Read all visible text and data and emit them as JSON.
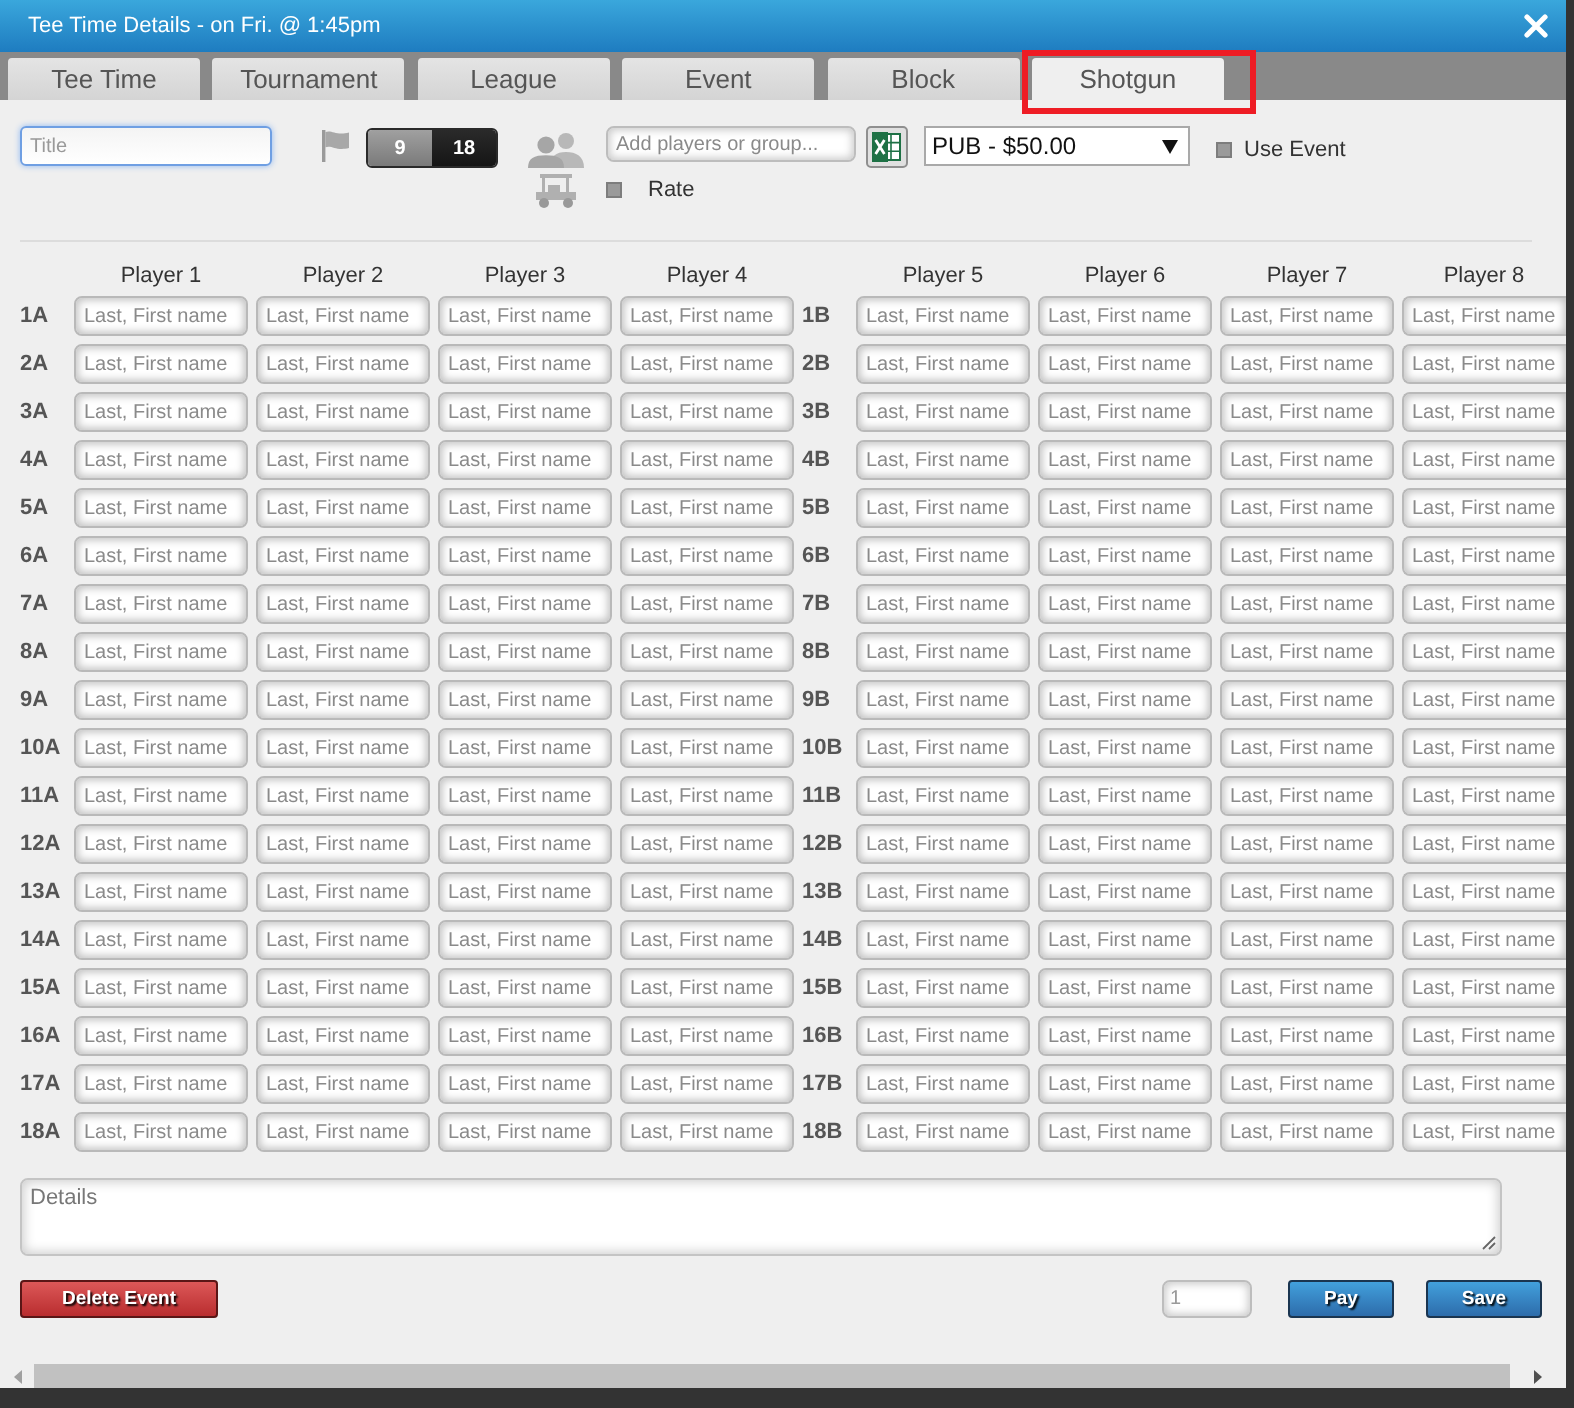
{
  "window": {
    "title": "Tee Time Details - on Fri. @ 1:45pm"
  },
  "tabs": [
    {
      "label": "Tee Time",
      "selected": false,
      "highlighted": false
    },
    {
      "label": "Tournament",
      "selected": false,
      "highlighted": false
    },
    {
      "label": "League",
      "selected": false,
      "highlighted": false
    },
    {
      "label": "Event",
      "selected": false,
      "highlighted": false
    },
    {
      "label": "Block",
      "selected": false,
      "highlighted": false
    },
    {
      "label": "Shotgun",
      "selected": true,
      "highlighted": true
    }
  ],
  "toolbar": {
    "title_field": {
      "placeholder": "Title",
      "focused": true
    },
    "holes": [
      {
        "label": "9",
        "selected": false
      },
      {
        "label": "18",
        "selected": true
      }
    ],
    "players_field": {
      "placeholder": "Add players or group..."
    },
    "rate_checkbox": {
      "label": "Rate",
      "checked": false
    },
    "rate_select": {
      "value": "PUB - $50.00"
    },
    "use_event_checkbox": {
      "label": "Use Event",
      "checked": false
    }
  },
  "grid": {
    "columns": [
      "Player 1",
      "Player 2",
      "Player 3",
      "Player 4",
      "Player 5",
      "Player 6",
      "Player 7",
      "Player 8"
    ],
    "rows": [
      {
        "label_a": "1A",
        "label_b": "1B",
        "slots": [
          {
            "placeholder": "Last, First name"
          },
          {
            "placeholder": "Last, First name"
          },
          {
            "placeholder": "Last, First name"
          },
          {
            "placeholder": "Last, First name"
          },
          {
            "placeholder": "Last, First name"
          },
          {
            "placeholder": "Last, First name"
          },
          {
            "placeholder": "Last, First name"
          },
          {
            "placeholder": "Last, First name"
          }
        ]
      },
      {
        "label_a": "2A",
        "label_b": "2B",
        "slots": [
          {
            "placeholder": "Last, First name"
          },
          {
            "placeholder": "Last, First name"
          },
          {
            "placeholder": "Last, First name"
          },
          {
            "placeholder": "Last, First name"
          },
          {
            "placeholder": "Last, First name"
          },
          {
            "placeholder": "Last, First name"
          },
          {
            "placeholder": "Last, First name"
          },
          {
            "placeholder": "Last, First name"
          }
        ]
      },
      {
        "label_a": "3A",
        "label_b": "3B",
        "slots": [
          {
            "placeholder": "Last, First name"
          },
          {
            "placeholder": "Last, First name"
          },
          {
            "placeholder": "Last, First name"
          },
          {
            "placeholder": "Last, First name"
          },
          {
            "placeholder": "Last, First name"
          },
          {
            "placeholder": "Last, First name"
          },
          {
            "placeholder": "Last, First name"
          },
          {
            "placeholder": "Last, First name"
          }
        ]
      },
      {
        "label_a": "4A",
        "label_b": "4B",
        "slots": [
          {
            "placeholder": "Last, First name"
          },
          {
            "placeholder": "Last, First name"
          },
          {
            "placeholder": "Last, First name"
          },
          {
            "placeholder": "Last, First name"
          },
          {
            "placeholder": "Last, First name"
          },
          {
            "placeholder": "Last, First name"
          },
          {
            "placeholder": "Last, First name"
          },
          {
            "placeholder": "Last, First name"
          }
        ]
      },
      {
        "label_a": "5A",
        "label_b": "5B",
        "slots": [
          {
            "placeholder": "Last, First name"
          },
          {
            "placeholder": "Last, First name"
          },
          {
            "placeholder": "Last, First name"
          },
          {
            "placeholder": "Last, First name"
          },
          {
            "placeholder": "Last, First name"
          },
          {
            "placeholder": "Last, First name"
          },
          {
            "placeholder": "Last, First name"
          },
          {
            "placeholder": "Last, First name"
          }
        ]
      },
      {
        "label_a": "6A",
        "label_b": "6B",
        "slots": [
          {
            "placeholder": "Last, First name"
          },
          {
            "placeholder": "Last, First name"
          },
          {
            "placeholder": "Last, First name"
          },
          {
            "placeholder": "Last, First name"
          },
          {
            "placeholder": "Last, First name"
          },
          {
            "placeholder": "Last, First name"
          },
          {
            "placeholder": "Last, First name"
          },
          {
            "placeholder": "Last, First name"
          }
        ]
      },
      {
        "label_a": "7A",
        "label_b": "7B",
        "slots": [
          {
            "placeholder": "Last, First name"
          },
          {
            "placeholder": "Last, First name"
          },
          {
            "placeholder": "Last, First name"
          },
          {
            "placeholder": "Last, First name"
          },
          {
            "placeholder": "Last, First name"
          },
          {
            "placeholder": "Last, First name"
          },
          {
            "placeholder": "Last, First name"
          },
          {
            "placeholder": "Last, First name"
          }
        ]
      },
      {
        "label_a": "8A",
        "label_b": "8B",
        "slots": [
          {
            "placeholder": "Last, First name"
          },
          {
            "placeholder": "Last, First name"
          },
          {
            "placeholder": "Last, First name"
          },
          {
            "placeholder": "Last, First name"
          },
          {
            "placeholder": "Last, First name"
          },
          {
            "placeholder": "Last, First name"
          },
          {
            "placeholder": "Last, First name"
          },
          {
            "placeholder": "Last, First name"
          }
        ]
      },
      {
        "label_a": "9A",
        "label_b": "9B",
        "slots": [
          {
            "placeholder": "Last, First name"
          },
          {
            "placeholder": "Last, First name"
          },
          {
            "placeholder": "Last, First name"
          },
          {
            "placeholder": "Last, First name"
          },
          {
            "placeholder": "Last, First name"
          },
          {
            "placeholder": "Last, First name"
          },
          {
            "placeholder": "Last, First name"
          },
          {
            "placeholder": "Last, First name"
          }
        ]
      },
      {
        "label_a": "10A",
        "label_b": "10B",
        "slots": [
          {
            "placeholder": "Last, First name"
          },
          {
            "placeholder": "Last, First name"
          },
          {
            "placeholder": "Last, First name"
          },
          {
            "placeholder": "Last, First name"
          },
          {
            "placeholder": "Last, First name"
          },
          {
            "placeholder": "Last, First name"
          },
          {
            "placeholder": "Last, First name"
          },
          {
            "placeholder": "Last, First name"
          }
        ]
      },
      {
        "label_a": "11A",
        "label_b": "11B",
        "slots": [
          {
            "placeholder": "Last, First name"
          },
          {
            "placeholder": "Last, First name"
          },
          {
            "placeholder": "Last, First name"
          },
          {
            "placeholder": "Last, First name"
          },
          {
            "placeholder": "Last, First name"
          },
          {
            "placeholder": "Last, First name"
          },
          {
            "placeholder": "Last, First name"
          },
          {
            "placeholder": "Last, First name"
          }
        ]
      },
      {
        "label_a": "12A",
        "label_b": "12B",
        "slots": [
          {
            "placeholder": "Last, First name"
          },
          {
            "placeholder": "Last, First name"
          },
          {
            "placeholder": "Last, First name"
          },
          {
            "placeholder": "Last, First name"
          },
          {
            "placeholder": "Last, First name"
          },
          {
            "placeholder": "Last, First name"
          },
          {
            "placeholder": "Last, First name"
          },
          {
            "placeholder": "Last, First name"
          }
        ]
      },
      {
        "label_a": "13A",
        "label_b": "13B",
        "slots": [
          {
            "placeholder": "Last, First name"
          },
          {
            "placeholder": "Last, First name"
          },
          {
            "placeholder": "Last, First name"
          },
          {
            "placeholder": "Last, First name"
          },
          {
            "placeholder": "Last, First name"
          },
          {
            "placeholder": "Last, First name"
          },
          {
            "placeholder": "Last, First name"
          },
          {
            "placeholder": "Last, First name"
          }
        ]
      },
      {
        "label_a": "14A",
        "label_b": "14B",
        "slots": [
          {
            "placeholder": "Last, First name"
          },
          {
            "placeholder": "Last, First name"
          },
          {
            "placeholder": "Last, First name"
          },
          {
            "placeholder": "Last, First name"
          },
          {
            "placeholder": "Last, First name"
          },
          {
            "placeholder": "Last, First name"
          },
          {
            "placeholder": "Last, First name"
          },
          {
            "placeholder": "Last, First name"
          }
        ]
      },
      {
        "label_a": "15A",
        "label_b": "15B",
        "slots": [
          {
            "placeholder": "Last, First name"
          },
          {
            "placeholder": "Last, First name"
          },
          {
            "placeholder": "Last, First name"
          },
          {
            "placeholder": "Last, First name"
          },
          {
            "placeholder": "Last, First name"
          },
          {
            "placeholder": "Last, First name"
          },
          {
            "placeholder": "Last, First name"
          },
          {
            "placeholder": "Last, First name"
          }
        ]
      },
      {
        "label_a": "16A",
        "label_b": "16B",
        "slots": [
          {
            "placeholder": "Last, First name"
          },
          {
            "placeholder": "Last, First name"
          },
          {
            "placeholder": "Last, First name"
          },
          {
            "placeholder": "Last, First name"
          },
          {
            "placeholder": "Last, First name"
          },
          {
            "placeholder": "Last, First name"
          },
          {
            "placeholder": "Last, First name"
          },
          {
            "placeholder": "Last, First name"
          }
        ]
      },
      {
        "label_a": "17A",
        "label_b": "17B",
        "slots": [
          {
            "placeholder": "Last, First name"
          },
          {
            "placeholder": "Last, First name"
          },
          {
            "placeholder": "Last, First name"
          },
          {
            "placeholder": "Last, First name"
          },
          {
            "placeholder": "Last, First name"
          },
          {
            "placeholder": "Last, First name"
          },
          {
            "placeholder": "Last, First name"
          },
          {
            "placeholder": "Last, First name"
          }
        ]
      },
      {
        "label_a": "18A",
        "label_b": "18B",
        "slots": [
          {
            "placeholder": "Last, First name"
          },
          {
            "placeholder": "Last, First name"
          },
          {
            "placeholder": "Last, First name"
          },
          {
            "placeholder": "Last, First name"
          },
          {
            "placeholder": "Last, First name"
          },
          {
            "placeholder": "Last, First name"
          },
          {
            "placeholder": "Last, First name"
          },
          {
            "placeholder": "Last, First name"
          }
        ]
      }
    ]
  },
  "details": {
    "placeholder": "Details"
  },
  "footer": {
    "delete_button": {
      "label": "Delete Event"
    },
    "quantity_field": {
      "placeholder": "1"
    },
    "buttons": [
      {
        "label": "Pay"
      },
      {
        "label": "Save"
      }
    ]
  }
}
